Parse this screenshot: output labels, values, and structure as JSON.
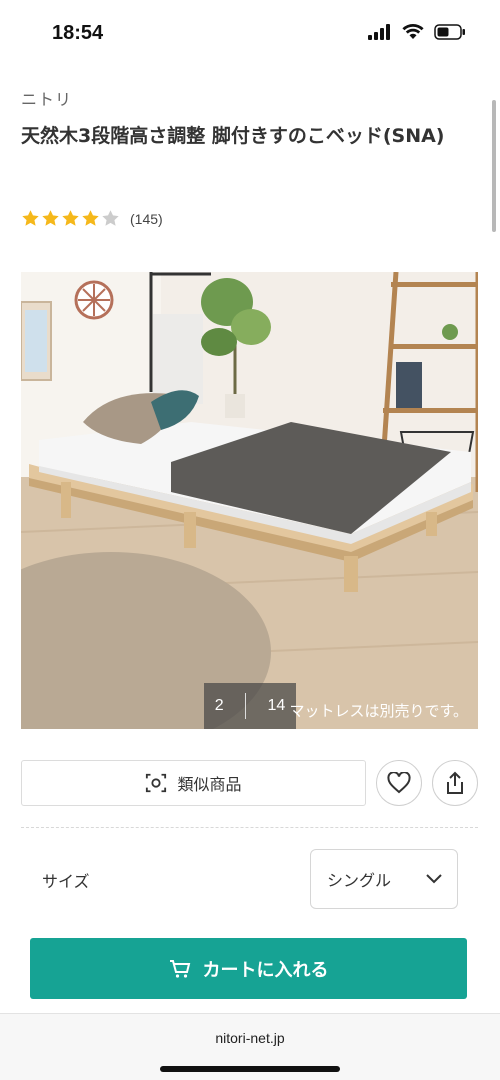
{
  "status_bar": {
    "time": "18:54",
    "icons": [
      "signal-icon",
      "wifi-icon",
      "battery-icon"
    ]
  },
  "product": {
    "brand": "ニトリ",
    "title": "天然木3段階高さ調整 脚付きすのこベッド(SNA)",
    "rating": {
      "stars": 4,
      "max_stars": 5,
      "count_text": "(145)"
    }
  },
  "gallery": {
    "current_index": "2",
    "total": "14",
    "caption": "マットレスは別売りです。"
  },
  "actions": {
    "similar_label": "類似商品",
    "similar_icon": "camera-scan-icon",
    "favorite_icon": "heart-icon",
    "share_icon": "share-icon"
  },
  "size_selector": {
    "label": "サイズ",
    "selected": "シングル",
    "icon": "chevron-down-icon"
  },
  "cart": {
    "label": "カートに入れる",
    "icon": "cart-icon"
  },
  "browser": {
    "domain": "nitori-net.jp"
  },
  "colors": {
    "accent": "#16a394",
    "star": "#f5b81b",
    "star_empty": "#cccccc"
  }
}
